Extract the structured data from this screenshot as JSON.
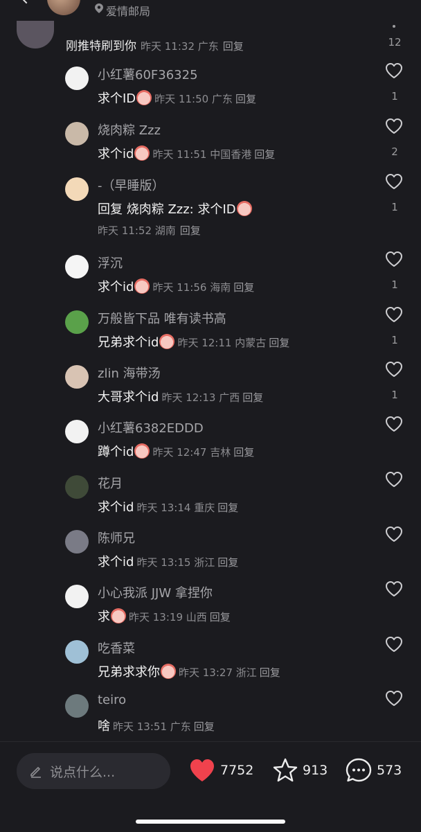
{
  "header": {
    "location_text": "爱情邮局"
  },
  "parent_comment": {
    "text": "刚推特刷到你",
    "meta": "昨天 11:32 广东",
    "reply_label": "回复",
    "likes": "12"
  },
  "replies": [
    {
      "name": "小红薯60F36325",
      "text": "求个ID",
      "emoji": true,
      "meta": "昨天 11:50 广东",
      "reply": "回复",
      "likes": "1"
    },
    {
      "name": "烧肉粽 Zzz",
      "text": "求个id",
      "emoji": true,
      "meta": "昨天 11:51 中国香港",
      "reply": "回复",
      "likes": "2"
    },
    {
      "name": "-（早睡版）",
      "text": "回复 烧肉粽 Zzz: 求个ID",
      "emoji": true,
      "meta": "昨天 11:52 湖南",
      "reply": "回复",
      "likes": "1"
    },
    {
      "name": "浮沉",
      "text": "求个id",
      "emoji": true,
      "meta": "昨天 11:56 海南",
      "reply": "回复",
      "likes": "1"
    },
    {
      "name": "万般皆下品 唯有读书高",
      "text": "兄弟求个id",
      "emoji": true,
      "meta": "昨天 12:11 内蒙古",
      "reply": "回复",
      "likes": "1"
    },
    {
      "name": "zlin 海带汤",
      "text": "大哥求个id",
      "emoji": false,
      "meta": "昨天 12:13 广西",
      "reply": "回复",
      "likes": "1"
    },
    {
      "name": "小红薯6382EDDD",
      "text": "蹲个id",
      "emoji": true,
      "meta": "昨天 12:47 吉林",
      "reply": "回复",
      "likes": ""
    },
    {
      "name": "花月",
      "text": "求个id",
      "emoji": false,
      "meta": "昨天 13:14 重庆",
      "reply": "回复",
      "likes": ""
    },
    {
      "name": "陈师兄",
      "text": "求个id",
      "emoji": false,
      "meta": "昨天 13:15 浙江",
      "reply": "回复",
      "likes": ""
    },
    {
      "name": "小心我派 JJW 拿捏你",
      "text": "求",
      "emoji": true,
      "meta": "昨天 13:19 山西",
      "reply": "回复",
      "likes": ""
    },
    {
      "name": "吃香菜",
      "text": "兄弟求求你",
      "emoji": true,
      "meta": "昨天 13:27 浙江",
      "reply": "回复",
      "likes": ""
    },
    {
      "name": "teiro",
      "text": "啥",
      "emoji": false,
      "meta": "昨天 13:51 广东",
      "reply": "回复",
      "likes": ""
    }
  ],
  "bottom_bar": {
    "input_placeholder": "说点什么...",
    "like_count": "7752",
    "star_count": "913",
    "comment_count": "573"
  },
  "colors": {
    "background": "#1b1b1f",
    "like_red": "#f0424d",
    "muted_text": "#8d8d91"
  }
}
